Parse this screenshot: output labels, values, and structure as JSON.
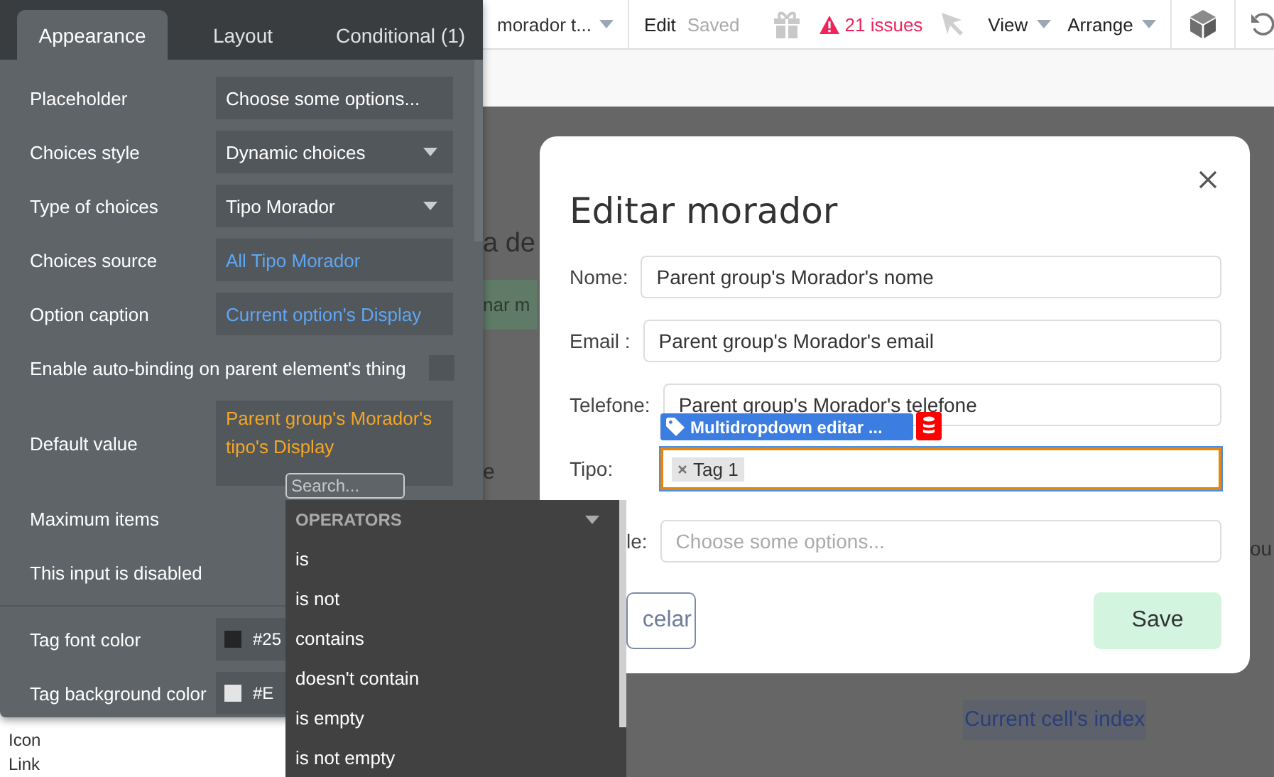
{
  "top_bar": {
    "page_dropdown": "morador t...",
    "edit": "Edit",
    "saved": "Saved",
    "issues": "21 issues",
    "view": "View",
    "arrange": "Arrange"
  },
  "canvas": {
    "heading_fragment": "a de",
    "button_fragment": "nar m",
    "text_fragment": "e",
    "group_fragment": "ou",
    "index_text": "Current cell's index",
    "sidebar_items": [
      "Icon",
      "Link"
    ]
  },
  "property_panel": {
    "tabs": [
      {
        "label": "Appearance",
        "selected": true
      },
      {
        "label": "Layout",
        "selected": false
      },
      {
        "label": "Conditional (1)",
        "selected": false
      }
    ],
    "rows": [
      {
        "kind": "text",
        "label": "Placeholder",
        "value": "Choose some options..."
      },
      {
        "kind": "dropdown",
        "label": "Choices style",
        "value": "Dynamic choices"
      },
      {
        "kind": "dropdown",
        "label": "Type of choices",
        "value": "Tipo Morador"
      },
      {
        "kind": "dynamic",
        "label": "Choices source",
        "value": "All Tipo Morador"
      },
      {
        "kind": "dynamic",
        "label": "Option caption",
        "value": "Current option's Display"
      },
      {
        "kind": "checkbox",
        "label": "Enable auto-binding on parent element's thing",
        "checked": false
      },
      {
        "kind": "expression",
        "label": "Default value",
        "value": "Parent group's Morador's tipo's Display"
      },
      {
        "kind": "label",
        "label": "Maximum items"
      },
      {
        "kind": "label",
        "label": "This input is disabled"
      },
      {
        "kind": "color",
        "label": "Tag font color",
        "value": "#25",
        "color": "#252525"
      },
      {
        "kind": "color",
        "label": "Tag background color",
        "value": "#E",
        "color": "#e4e4e4"
      }
    ]
  },
  "operator_menu": {
    "search_placeholder": "Search...",
    "header": "OPERATORS",
    "items": [
      "is",
      "is not",
      "contains",
      "doesn't contain",
      "is empty",
      "is not empty"
    ]
  },
  "modal": {
    "title": "Editar morador",
    "element_badge": "Multidropdown editar ...",
    "fields": [
      {
        "kind": "text",
        "label": "Nome:",
        "value": "Parent group's Morador's nome"
      },
      {
        "kind": "text",
        "label": "Email :",
        "value": "Parent group's Morador's email"
      },
      {
        "kind": "text",
        "label": "Telefone:",
        "value": "Parent group's Morador's telefone"
      },
      {
        "kind": "tags",
        "label": "Tipo:",
        "tags": [
          "Tag 1"
        ],
        "focused": true
      },
      {
        "kind": "text",
        "label": "le:",
        "placeholder": "Choose some options..."
      }
    ],
    "cancel": "celar",
    "save": "Save"
  }
}
